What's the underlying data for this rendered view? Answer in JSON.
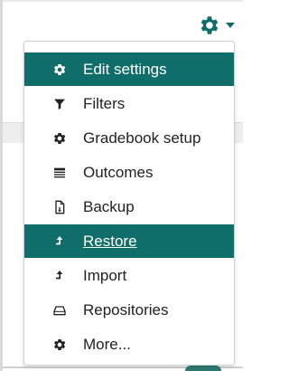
{
  "colors": {
    "accent": "#0f6e6a",
    "text": "#222222",
    "active_text": "#ffffff"
  },
  "toggle": {
    "icon": "gear-icon",
    "caret": "chevron-down-icon"
  },
  "menu": {
    "items": [
      {
        "label": "Edit settings",
        "icon": "gear-icon",
        "active": true
      },
      {
        "label": "Filters",
        "icon": "filter-icon",
        "active": false
      },
      {
        "label": "Gradebook setup",
        "icon": "gear-icon",
        "active": false
      },
      {
        "label": "Outcomes",
        "icon": "list-icon",
        "active": false
      },
      {
        "label": "Backup",
        "icon": "document-icon",
        "active": false
      },
      {
        "label": "Restore",
        "icon": "upload-icon",
        "active": true,
        "hovered": true
      },
      {
        "label": "Import",
        "icon": "upload-icon",
        "active": false
      },
      {
        "label": "Repositories",
        "icon": "drive-icon",
        "active": false
      },
      {
        "label": "More...",
        "icon": "gear-icon",
        "active": false
      }
    ]
  }
}
